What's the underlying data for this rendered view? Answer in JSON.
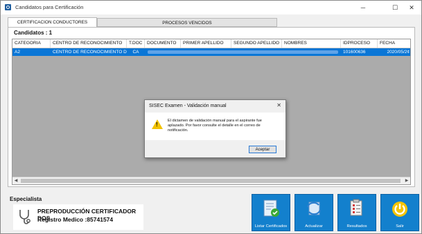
{
  "window": {
    "title": "Candidatos para Certificación",
    "minimize": "─",
    "maximize": "☐",
    "close": "✕"
  },
  "tabs": [
    {
      "label": "CERTIFICACION CONDUCTORES"
    },
    {
      "label": "PROCESOS VENCIDOS"
    }
  ],
  "grid": {
    "count_label": "Candidatos : 1",
    "columns": [
      "CATEGORIA",
      "CENTRO DE RECONOCIMIENTO",
      "T.DOC",
      "DOCUMENTO",
      "PRIMER APELLIDO",
      "SEGUNDO APELLIDO",
      "NOMBRES",
      "IDPROCESO",
      "FECHA"
    ],
    "rows": [
      {
        "categoria": "A2",
        "centro": "CENTRO DE RECONOCIMIENTO DE ...",
        "tdoc": "CA",
        "idproceso": "101600636",
        "fecha": "2020/05/2¢"
      }
    ]
  },
  "dialog": {
    "title": "SISEC Examen - Validación manual",
    "close": "✕",
    "message": "El dictamen de validación manual para el aspirante fue aplazado. Por favor consulte el detalle en el correo de notificación.",
    "ok_label": "Aceptar",
    "icon": "warning-icon"
  },
  "specialist": {
    "label": "Especialista",
    "name": "PREPRODUCCIÓN CERTIFICADOR DOS",
    "registry": "Registro Medico :85741574",
    "icon": "stethoscope-icon"
  },
  "actions": [
    {
      "label": "Listar Certificados",
      "icon": "certificate-list-icon"
    },
    {
      "label": "Actualizar",
      "icon": "refresh-icon"
    },
    {
      "label": "Resultados",
      "icon": "results-icon"
    },
    {
      "label": "Salir",
      "icon": "power-icon"
    }
  ],
  "colors": {
    "selection": "#0a76d6",
    "action_button": "#1380cd",
    "warning": "#f2c200"
  }
}
